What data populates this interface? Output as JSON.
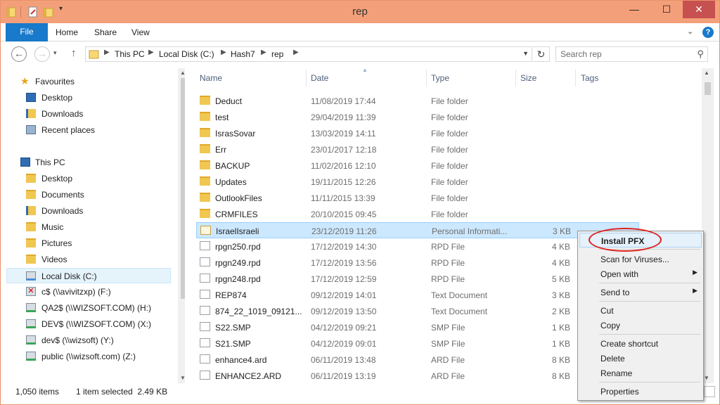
{
  "window": {
    "title": "rep"
  },
  "ribbon": {
    "file": "File",
    "home": "Home",
    "share": "Share",
    "view": "View",
    "help": "?"
  },
  "address": {
    "crumbs": [
      "This PC",
      "Local Disk (C:)",
      "Hash7",
      "rep"
    ],
    "search_placeholder": "Search rep"
  },
  "nav": {
    "favourites": {
      "label": "Favourites",
      "items": [
        "Desktop",
        "Downloads",
        "Recent places"
      ]
    },
    "this_pc": {
      "label": "This PC",
      "items": [
        "Desktop",
        "Documents",
        "Downloads",
        "Music",
        "Pictures",
        "Videos",
        "Local Disk (C:)",
        "c$ (\\\\avivitzxp) (F:)",
        "QA2$ (\\\\WIZSOFT.COM) (H:)",
        "DEV$ (\\\\WIZSOFT.COM) (X:)",
        "dev$ (\\\\wizsoft) (Y:)",
        "public (\\\\wizsoft.com) (Z:)"
      ]
    }
  },
  "columns": {
    "name": "Name",
    "date": "Date",
    "type": "Type",
    "size": "Size",
    "tags": "Tags"
  },
  "files": [
    {
      "name": "Deduct",
      "date": "11/08/2019 17:44",
      "type": "File folder",
      "size": "",
      "kind": "folder"
    },
    {
      "name": "test",
      "date": "29/04/2019 11:39",
      "type": "File folder",
      "size": "",
      "kind": "folder"
    },
    {
      "name": "IsrasSovar",
      "date": "13/03/2019 14:11",
      "type": "File folder",
      "size": "",
      "kind": "folder"
    },
    {
      "name": "Err",
      "date": "23/01/2017 12:18",
      "type": "File folder",
      "size": "",
      "kind": "folder"
    },
    {
      "name": "BACKUP",
      "date": "11/02/2016 12:10",
      "type": "File folder",
      "size": "",
      "kind": "folder"
    },
    {
      "name": "Updates",
      "date": "19/11/2015 12:26",
      "type": "File folder",
      "size": "",
      "kind": "folder"
    },
    {
      "name": "OutlookFiles",
      "date": "11/11/2015 13:39",
      "type": "File folder",
      "size": "",
      "kind": "folder"
    },
    {
      "name": "CRMFILES",
      "date": "20/10/2015 09:45",
      "type": "File folder",
      "size": "",
      "kind": "folder"
    },
    {
      "name": "IsraelIsraeli",
      "date": "23/12/2019 11:26",
      "type": "Personal Informati...",
      "size": "3 KB",
      "kind": "cert"
    },
    {
      "name": "rpgn250.rpd",
      "date": "17/12/2019 14:30",
      "type": "RPD File",
      "size": "4 KB",
      "kind": "doc"
    },
    {
      "name": "rpgn249.rpd",
      "date": "17/12/2019 13:56",
      "type": "RPD File",
      "size": "4 KB",
      "kind": "doc"
    },
    {
      "name": "rpgn248.rpd",
      "date": "17/12/2019 12:59",
      "type": "RPD File",
      "size": "5 KB",
      "kind": "doc"
    },
    {
      "name": "REP874",
      "date": "09/12/2019 14:01",
      "type": "Text Document",
      "size": "3 KB",
      "kind": "text"
    },
    {
      "name": "874_22_1019_09121...",
      "date": "09/12/2019 13:50",
      "type": "Text Document",
      "size": "2 KB",
      "kind": "text"
    },
    {
      "name": "S22.SMP",
      "date": "04/12/2019 09:21",
      "type": "SMP File",
      "size": "1 KB",
      "kind": "doc"
    },
    {
      "name": "S21.SMP",
      "date": "04/12/2019 09:01",
      "type": "SMP File",
      "size": "1 KB",
      "kind": "doc"
    },
    {
      "name": "enhance4.ard",
      "date": "06/11/2019 13:48",
      "type": "ARD File",
      "size": "8 KB",
      "kind": "doc"
    },
    {
      "name": "ENHANCE2.ARD",
      "date": "06/11/2019 13:19",
      "type": "ARD File",
      "size": "8 KB",
      "kind": "doc"
    }
  ],
  "status": {
    "count": "1,050 items",
    "selection": "1 item selected  2.49 KB"
  },
  "context_menu": {
    "install": "Install PFX",
    "scan": "Scan for Viruses...",
    "open_with": "Open with",
    "send_to": "Send to",
    "cut": "Cut",
    "copy": "Copy",
    "create_shortcut": "Create shortcut",
    "delete": "Delete",
    "rename": "Rename",
    "properties": "Properties"
  }
}
